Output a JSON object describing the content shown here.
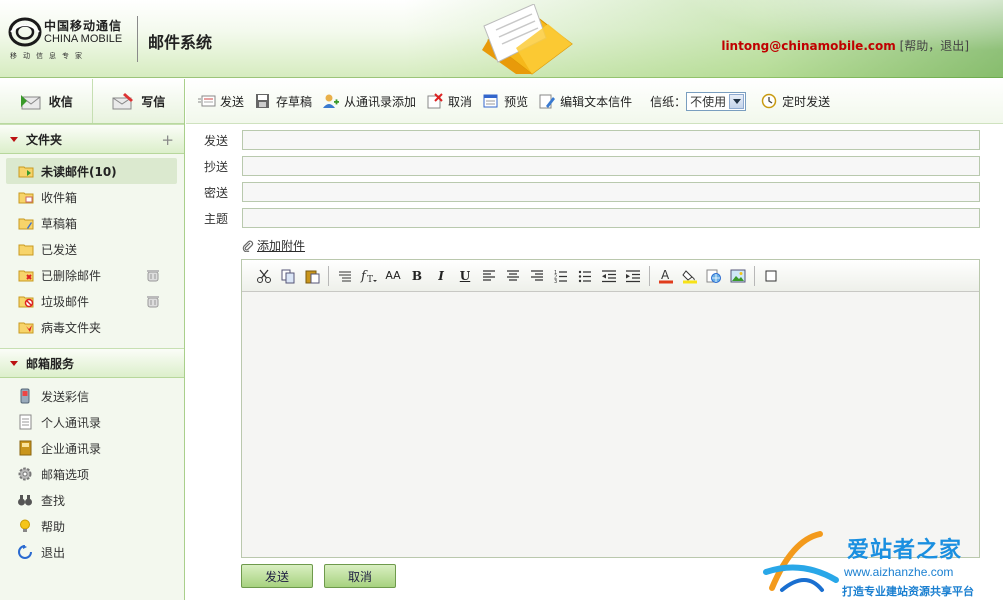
{
  "header": {
    "logo_cn": "中国移动通信",
    "logo_en": "CHINA MOBILE",
    "logo_slogan": "移动信息专家",
    "system_title": "邮件系统",
    "user_email": "lintong@chinamobile.com",
    "help_link": "帮助",
    "logout_link": "退出",
    "open_bracket": "[",
    "separator": "，",
    "close_bracket": "]"
  },
  "sidebar": {
    "receive_label": "收信",
    "compose_label": "写信",
    "folders_title": "文件夹",
    "add_folder_symbol": "+",
    "folders": [
      {
        "label": "未读邮件(10)",
        "icon": "folder-unread-icon"
      },
      {
        "label": "收件箱",
        "icon": "folder-inbox-icon"
      },
      {
        "label": "草稿箱",
        "icon": "folder-drafts-icon"
      },
      {
        "label": "已发送",
        "icon": "folder-sent-icon"
      },
      {
        "label": "已删除邮件",
        "icon": "folder-deleted-icon"
      },
      {
        "label": "垃圾邮件",
        "icon": "folder-spam-icon"
      },
      {
        "label": "病毒文件夹",
        "icon": "folder-virus-icon"
      }
    ],
    "services_title": "邮箱服务",
    "services": [
      {
        "label": "发送彩信",
        "icon": "mms-phone-icon"
      },
      {
        "label": "个人通讯录",
        "icon": "personal-contacts-icon"
      },
      {
        "label": "企业通讯录",
        "icon": "enterprise-contacts-icon"
      },
      {
        "label": "邮箱选项",
        "icon": "gear-icon"
      },
      {
        "label": "查找",
        "icon": "binoculars-icon"
      },
      {
        "label": "帮助",
        "icon": "lightbulb-icon"
      },
      {
        "label": "退出",
        "icon": "logout-arrow-icon"
      }
    ]
  },
  "toolbar": {
    "send": "发送",
    "save_draft": "存草稿",
    "add_from_contacts": "从通讯录添加",
    "cancel": "取消",
    "preview": "预览",
    "edit_text_mail": "编辑文本信件",
    "stationery_label": "信纸：",
    "stationery_value": "不使用",
    "scheduled_send": "定时发送"
  },
  "form": {
    "to_label": "发送",
    "to_value": "",
    "cc_label": "抄送",
    "cc_value": "",
    "bcc_label": "密送",
    "bcc_value": "",
    "subject_label": "主题",
    "subject_value": "",
    "add_attachment": "添加附件",
    "body": ""
  },
  "editor_tools": {
    "bold": "B",
    "italic": "I",
    "underline": "U",
    "font_size": "AA"
  },
  "buttons": {
    "send": "发送",
    "cancel": "取消"
  },
  "watermark": {
    "name": "爱站者之家",
    "url": "www.aizhanzhe.com",
    "slogan": "打造专业建站资源共享平台"
  },
  "colors": {
    "accent_green": "#a7d27f",
    "email_red": "#c00000",
    "watermark_blue": "#1a8fe0"
  }
}
